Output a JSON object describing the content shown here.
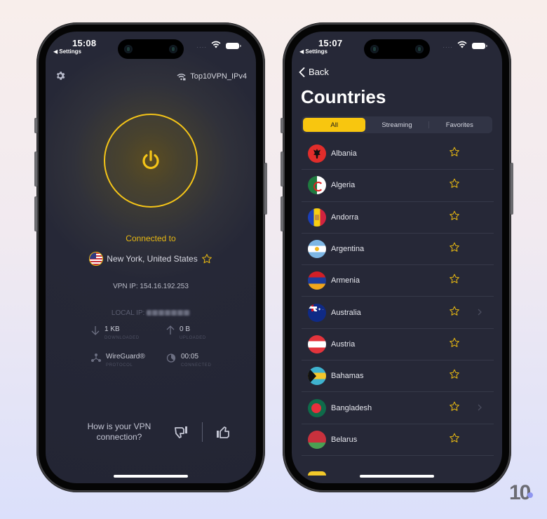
{
  "colors": {
    "accent": "#f5c518",
    "screen_bg": "#262837",
    "star": "#e7b812"
  },
  "left_phone": {
    "status": {
      "time": "15:08",
      "back_app": "◀ Settings",
      "signal": "····"
    },
    "settings_icon": "gear-icon",
    "network": {
      "icon": "wifi-lock-icon",
      "name": "Top10VPN_IPv4"
    },
    "power_button": {
      "icon": "power-icon",
      "state": "connected"
    },
    "connected_label": "Connected to",
    "location": {
      "flag": "us",
      "name": "New York, United States",
      "favorite_icon": "star-outline-icon"
    },
    "vpn_ip": "VPN IP: 154.16.192.253",
    "local_ip_label": "LOCAL IP:",
    "stats": [
      {
        "icon": "arrow-down-icon",
        "value": "1 KB",
        "label": "DOWNLOADED"
      },
      {
        "icon": "arrow-up-icon",
        "value": "0 B",
        "label": "UPLOADED"
      },
      {
        "icon": "protocol-icon",
        "value": "WireGuard®",
        "label": "PROTOCOL"
      },
      {
        "icon": "timer-icon",
        "value": "00:05",
        "label": "CONNECTED"
      }
    ],
    "feedback": {
      "question": "How is your VPN connection?",
      "thumbs_down": "thumbs-down-icon",
      "thumbs_up": "thumbs-up-icon"
    }
  },
  "right_phone": {
    "status": {
      "time": "15:07",
      "back_app": "◀ Settings",
      "signal": "····"
    },
    "back_label": "Back",
    "title": "Countries",
    "tabs": [
      {
        "label": "All",
        "active": true
      },
      {
        "label": "Streaming",
        "active": false
      },
      {
        "label": "Favorites",
        "active": false
      }
    ],
    "countries": [
      {
        "name": "Albania",
        "flag": "albania",
        "favorite": false,
        "has_chevron": false
      },
      {
        "name": "Algeria",
        "flag": "algeria",
        "favorite": false,
        "has_chevron": false
      },
      {
        "name": "Andorra",
        "flag": "andorra",
        "favorite": false,
        "has_chevron": false
      },
      {
        "name": "Argentina",
        "flag": "argentina",
        "favorite": false,
        "has_chevron": false
      },
      {
        "name": "Armenia",
        "flag": "armenia",
        "favorite": false,
        "has_chevron": false
      },
      {
        "name": "Australia",
        "flag": "australia",
        "favorite": false,
        "has_chevron": true
      },
      {
        "name": "Austria",
        "flag": "austria",
        "favorite": false,
        "has_chevron": false
      },
      {
        "name": "Bahamas",
        "flag": "bahamas",
        "favorite": false,
        "has_chevron": false
      },
      {
        "name": "Bangladesh",
        "flag": "bangladesh",
        "favorite": false,
        "has_chevron": true
      },
      {
        "name": "Belarus",
        "flag": "belarus",
        "favorite": false,
        "has_chevron": false
      }
    ]
  },
  "brand": {
    "logo_text": "10"
  }
}
